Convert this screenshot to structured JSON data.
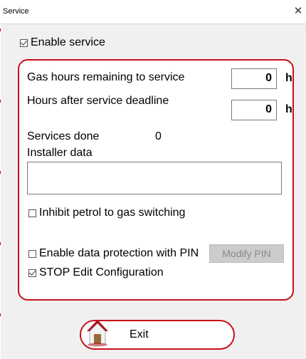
{
  "window": {
    "title": "Service"
  },
  "enable_service": {
    "label": "Enable service",
    "checked": true
  },
  "fields": {
    "gas_hours_label": "Gas hours remaining to service",
    "gas_hours_value": "0",
    "gas_hours_unit": "h",
    "hours_after_label": "Hours after service deadline",
    "hours_after_value": "0",
    "hours_after_unit": "h",
    "services_done_label": "Services done",
    "services_done_value": "0",
    "installer_label": "Installer data",
    "installer_value": ""
  },
  "options": {
    "inhibit_label": "Inhibit petrol to gas switching",
    "inhibit_checked": false,
    "protection_label": "Enable data protection with PIN",
    "protection_checked": false,
    "stop_edit_label": "STOP Edit Configuration",
    "stop_edit_checked": true
  },
  "buttons": {
    "modify_pin": "Modify PIN",
    "exit": "Exit"
  },
  "colors": {
    "accent": "#c8101a",
    "panel": "#ffffff",
    "background": "#f0f0f0",
    "disabled": "#cccccc"
  },
  "icons": {
    "exit": "house-icon",
    "close": "close-icon"
  }
}
